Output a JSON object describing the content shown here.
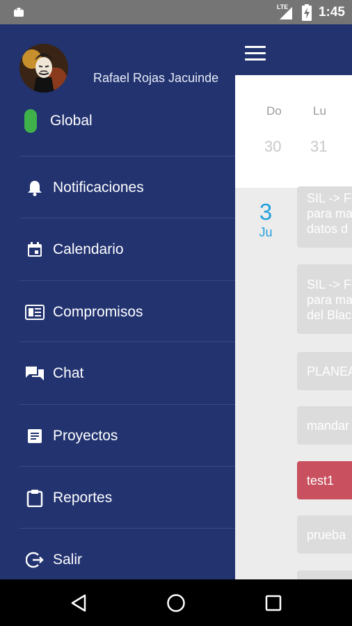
{
  "status_bar": {
    "time": "1:45",
    "network": "LTE",
    "icons": [
      "android-icon",
      "signal-icon",
      "battery-charging-icon"
    ]
  },
  "drawer": {
    "user_name": "Rafael Rojas Jacuinde",
    "items": [
      {
        "label": "Global",
        "icon": "global-status-indicator",
        "color": "#3fb14a"
      },
      {
        "label": "Notificaciones",
        "icon": "bell-icon"
      },
      {
        "label": "Calendario",
        "icon": "calendar-icon"
      },
      {
        "label": "Compromisos",
        "icon": "newspaper-icon"
      },
      {
        "label": "Chat",
        "icon": "chat-icon"
      },
      {
        "label": "Proyectos",
        "icon": "document-icon"
      },
      {
        "label": "Reportes",
        "icon": "clipboard-icon"
      },
      {
        "label": "Salir",
        "icon": "logout-icon"
      }
    ]
  },
  "calendar": {
    "week_days": [
      {
        "name": "Do",
        "num": "30"
      },
      {
        "name": "Lu",
        "num": "31"
      }
    ],
    "selected_date": {
      "num": "3",
      "dow": "Ju"
    },
    "events": [
      {
        "lines": [
          "SIL -> Fo",
          "para ma",
          "datos d"
        ],
        "color": "#dcdcdc"
      },
      {
        "lines": [
          "SIL -> Fo",
          "para ma",
          "del Blac"
        ],
        "color": "#dcdcdc"
      },
      {
        "lines": [
          "PLANEA"
        ],
        "color": "#dcdcdc"
      },
      {
        "lines": [
          "mandar"
        ],
        "color": "#dcdcdc"
      },
      {
        "lines": [
          "test1"
        ],
        "color": "#c9505e"
      },
      {
        "lines": [
          "prueba"
        ],
        "color": "#dcdcdc"
      }
    ]
  },
  "colors": {
    "primary": "#223370",
    "accent": "#21a0db",
    "status_bar": "#757575"
  }
}
